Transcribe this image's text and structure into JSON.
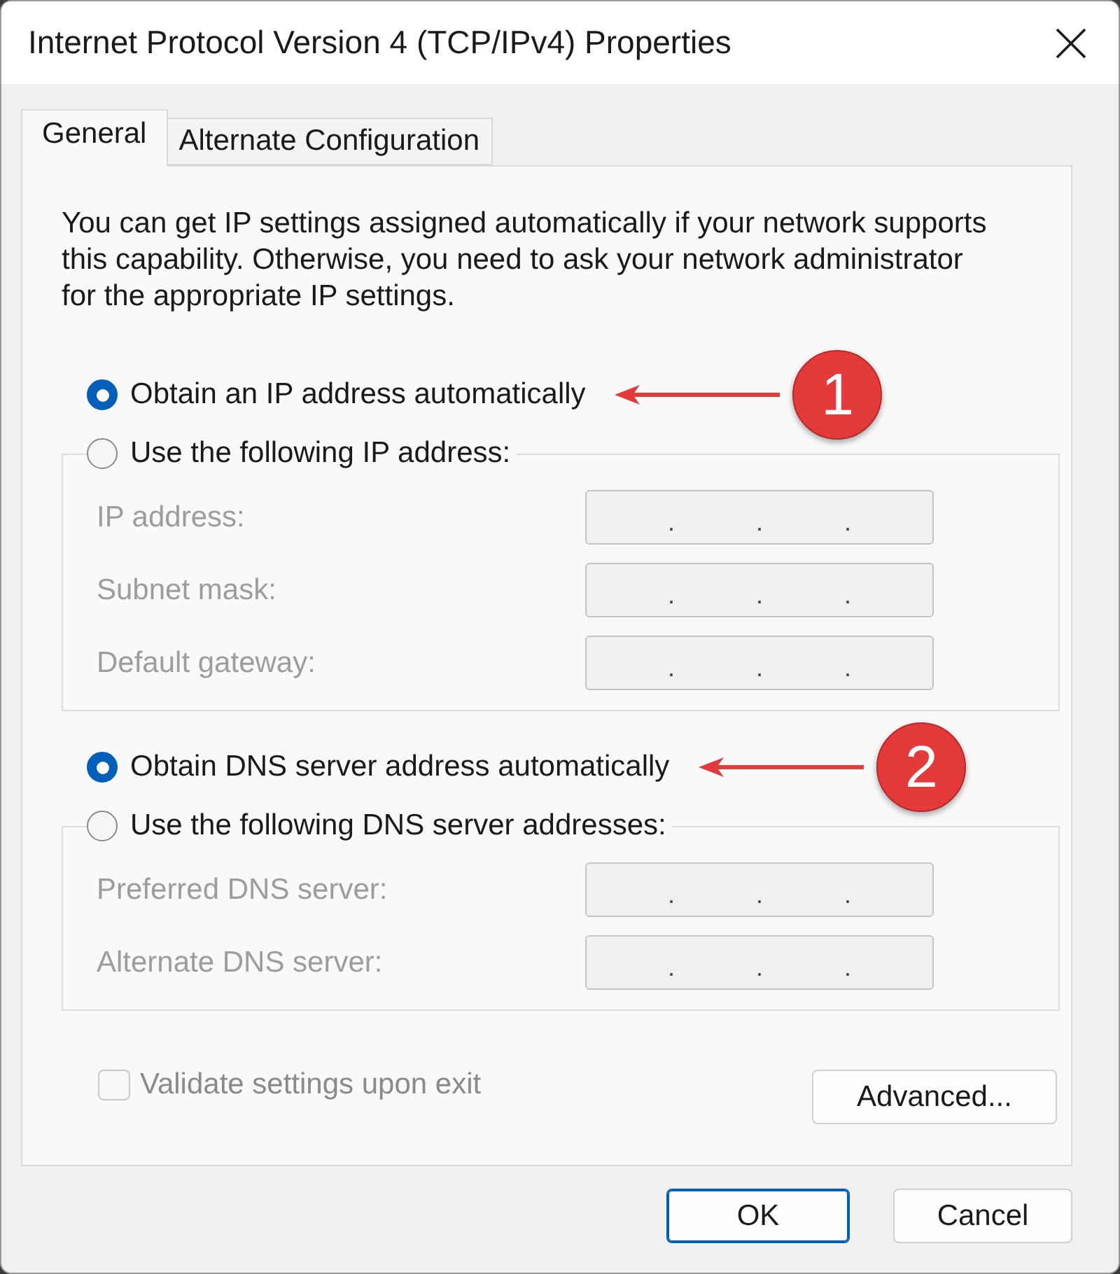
{
  "window": {
    "title": "Internet Protocol Version 4 (TCP/IPv4) Properties"
  },
  "tabs": [
    {
      "label": "General",
      "selected": true
    },
    {
      "label": "Alternate Configuration",
      "selected": false
    }
  ],
  "description": "You can get IP settings assigned automatically if your network supports this capability. Otherwise, you need to ask your network administrator for the appropriate IP settings.",
  "ip_section": {
    "auto": {
      "label": "Obtain an IP address automatically",
      "selected": true,
      "callout": "1"
    },
    "manual": {
      "label": "Use the following IP address:",
      "selected": false
    },
    "fields": [
      {
        "label": "IP address:",
        "disabled": true,
        "separators": [
          ".",
          ".",
          "."
        ]
      },
      {
        "label": "Subnet mask:",
        "disabled": true,
        "separators": [
          ".",
          ".",
          "."
        ]
      },
      {
        "label": "Default gateway:",
        "disabled": true,
        "separators": [
          ".",
          ".",
          "."
        ]
      }
    ]
  },
  "dns_section": {
    "auto": {
      "label": "Obtain DNS server address automatically",
      "selected": true,
      "callout": "2"
    },
    "manual": {
      "label": "Use the following DNS server addresses:",
      "selected": false
    },
    "fields": [
      {
        "label": "Preferred DNS server:",
        "disabled": true,
        "separators": [
          ".",
          ".",
          "."
        ]
      },
      {
        "label": "Alternate DNS server:",
        "disabled": true,
        "separators": [
          ".",
          ".",
          "."
        ]
      }
    ]
  },
  "validate": {
    "label": "Validate settings upon exit",
    "checked": false,
    "disabled": true
  },
  "advanced": {
    "label": "Advanced..."
  },
  "buttons": [
    {
      "label": "OK",
      "default": true
    },
    {
      "label": "Cancel",
      "default": false
    }
  ]
}
